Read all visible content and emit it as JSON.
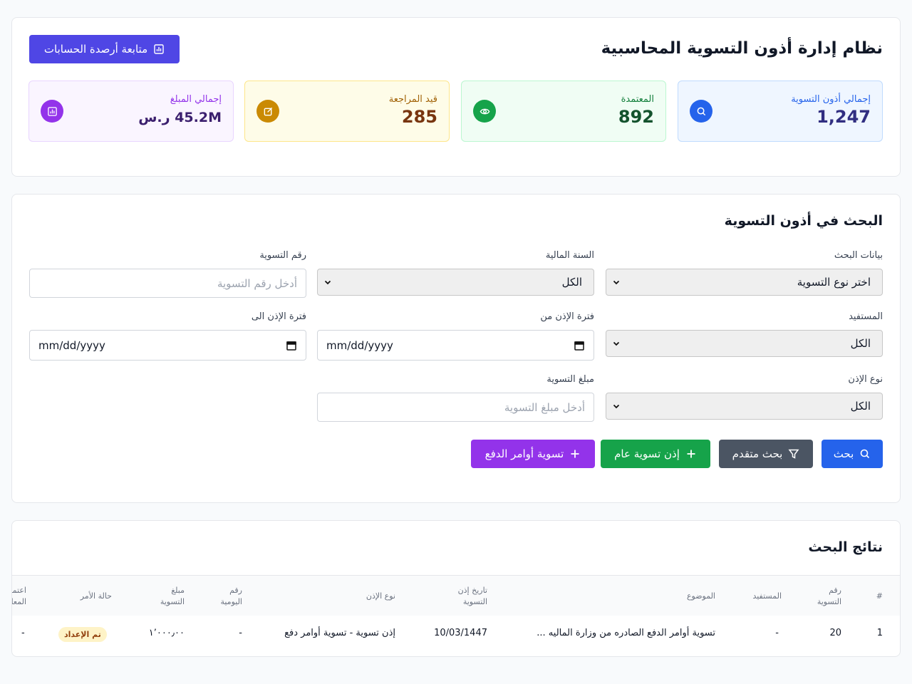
{
  "header": {
    "title": "نظام إدارة أذون التسوية المحاسبية",
    "balances_button": "متابعة أرصدة الحسابات"
  },
  "stats": [
    {
      "label": "إجمالي أذون التسوية",
      "value": "1,247",
      "icon": "search-icon",
      "color": "#2563eb"
    },
    {
      "label": "المعتمدة",
      "value": "892",
      "icon": "eye-icon",
      "color": "#16a34a"
    },
    {
      "label": "قيد المراجعة",
      "value": "285",
      "icon": "edit-icon",
      "color": "#ca8a04"
    },
    {
      "label": "إجمالي المبلغ",
      "value": "45.2M ر.س",
      "icon": "chart-icon",
      "color": "#9333ea"
    }
  ],
  "search": {
    "title": "البحث في أذون التسوية",
    "fields": {
      "search_data": {
        "label": "بيانات البحث",
        "value": "اختر نوع التسوية"
      },
      "fiscal_year": {
        "label": "السنة المالية",
        "value": "الكل"
      },
      "settlement_number": {
        "label": "رقم التسوية",
        "placeholder": "أدخل رقم التسوية"
      },
      "beneficiary": {
        "label": "المستفيد",
        "value": "الكل"
      },
      "period_from": {
        "label": "فترة الإذن من",
        "value": "mm/dd/yyyy"
      },
      "period_to": {
        "label": "فترة الإذن الى",
        "value": "mm/dd/yyyy"
      },
      "permit_type": {
        "label": "نوع الإذن",
        "value": "الكل"
      },
      "settlement_amount": {
        "label": "مبلغ التسوية",
        "placeholder": "أدخل مبلغ التسوية"
      }
    },
    "buttons": {
      "search": "بحث",
      "advanced": "بحث متقدم",
      "general_permit": "إذن تسوية عام",
      "payment_orders": "تسوية أوامر الدفع"
    }
  },
  "results": {
    "title": "نتائج البحث",
    "columns": [
      "#",
      "رقم التسوية",
      "المستفيد",
      "الموضوع",
      "تاريخ إذن التسوية",
      "نوع الإذن",
      "رقم اليومية",
      "مبلغ التسوية",
      "حالة الأمر",
      "اعتماد المعاملة"
    ],
    "rows": [
      {
        "index": "1",
        "number": "20",
        "beneficiary": "-",
        "subject": "تسوية أوامر الدفع الصادره من وزارة الماليه ...",
        "date": "10/03/1447",
        "type": "إذن تسوية - تسوية أوامر دفع",
        "journal": "-",
        "amount": "١٬٠٠٠٫٠٠",
        "status": "تم الإعداد",
        "approval": "-"
      }
    ]
  }
}
